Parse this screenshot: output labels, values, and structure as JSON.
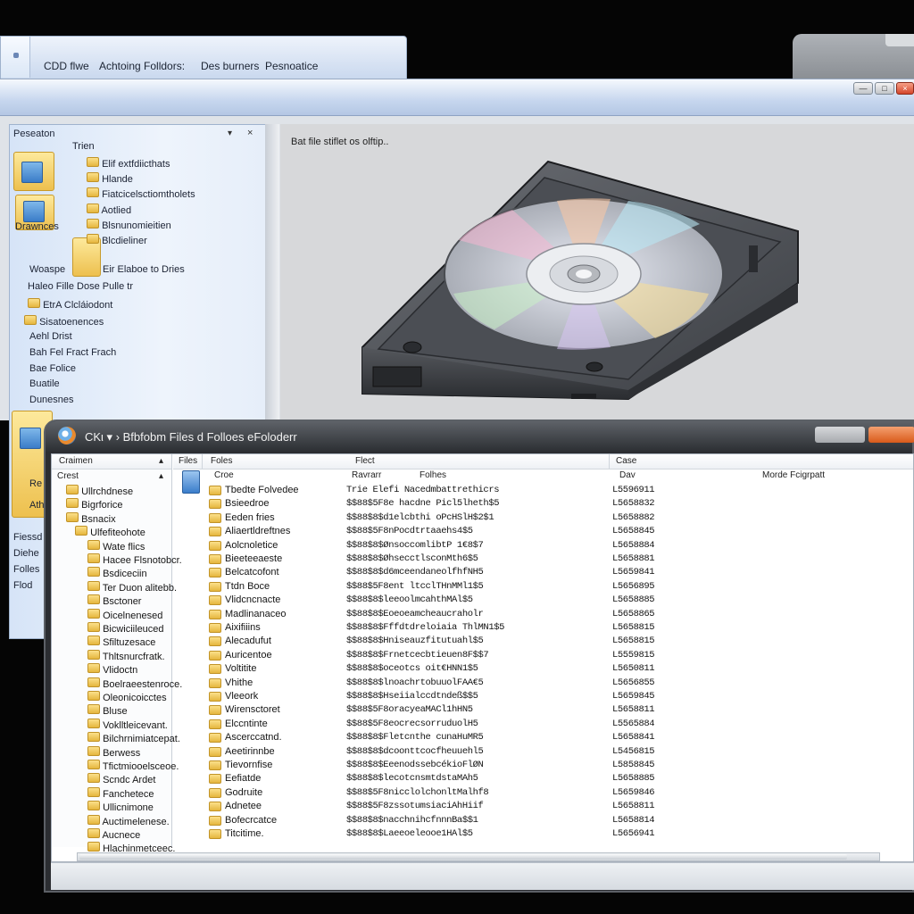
{
  "top_tabs": {
    "items": [
      "CDD flwe",
      "Achtoing Folldors:",
      "Des burners",
      "Pesnoatice"
    ]
  },
  "bg_window": {
    "nav_header": "Peseaton",
    "nav_items": [
      {
        "label": "Trien"
      },
      {
        "label": "Elif extfdiicthats"
      },
      {
        "label": "Hlande"
      },
      {
        "label": "Fiatcicelsctiomtholets"
      },
      {
        "label": "Aotlied"
      },
      {
        "label": "Blsnunomieitien"
      },
      {
        "label": "Blcdieliner"
      },
      {
        "label": "Drawnces"
      },
      {
        "label": "Woaspe"
      },
      {
        "label": "Eir Elaboe to Dries"
      },
      {
        "label": "Haleo Fille Dose Pulle tr"
      },
      {
        "label": "EtrA Clcláiodont"
      },
      {
        "label": "Sisatoenences"
      },
      {
        "label": "Aehl Drist"
      },
      {
        "label": "Bah Fel Fract Frach"
      },
      {
        "label": "Bae Folice"
      },
      {
        "label": "Buatile"
      },
      {
        "label": "Dunesnes"
      }
    ],
    "left_edge_labels": [
      "Fiessd",
      "Diehe",
      "Folles",
      "Flod",
      "Re",
      "Ath"
    ],
    "preview_caption": "Bat file stiflet os olftip.."
  },
  "front_window": {
    "title": "CKι ▾ › Bfbfobm Files d Folloes eFoloderr",
    "nav_header": "Craimen",
    "nav_subheader": "Crest",
    "nav_items": [
      "Ullrchdnese",
      "Bigrforice",
      "Bsnacix",
      "Ulfefiteohote",
      "Wate flics",
      "Hacee Flsnotobcr.",
      "Bsdiceciin",
      "Ter Duon alitebb.",
      "Bsctoner",
      "Oicelnenesed",
      "Bicwiciileuced",
      "Sfiltuzesace",
      "Thltsnurcfratk.",
      "Vlidoctn",
      "Boelraeestenroce.",
      "Oleonicoicctes",
      "Bluse",
      "Voklltleicevant.",
      "Bilchrnimiatcepat.",
      "Berwess",
      "Tfictmiooelsceoe.",
      "Scndc Ardet",
      "Fanchetece",
      "Ullicnimone",
      "Auctimelenese.",
      "Aucnece",
      "Hlachinmetceec."
    ],
    "columns": {
      "files": "Files",
      "foles": "Foles",
      "flect": "Flect",
      "case": "Case",
      "sub_name": "Croe",
      "sub_type": "Ravrarr",
      "sub_fold": "Folhes",
      "sub_date": "Dav",
      "sub_extra": "Morde Fcigrpatt"
    },
    "rows": [
      {
        "name": "Tbedte Folvedee",
        "type": "Trie Elefi Nacedmbattrethicrs",
        "date": "L5596911"
      },
      {
        "name": "Bsieedroe",
        "type": "$$88$5F8e hacdne Picl5lheth$5",
        "date": "L5658832"
      },
      {
        "name": "Eeden fries",
        "type": "$$88$8$d1elcbthi oPcHSlH$2$1",
        "date": "L5658882"
      },
      {
        "name": "Aliaertldreftnes",
        "type": "$$88$5F8nPocdtrtaaehs4$5",
        "date": "L5658845"
      },
      {
        "name": "Aolcnoletice",
        "type": "$$88$8$ØnsoccomlibtP 1€8$7",
        "date": "L5658884"
      },
      {
        "name": "Bieeteeaeste",
        "type": "$$88$8$ØhsecctlsconMth6$5",
        "date": "L5658881"
      },
      {
        "name": "Belcatcofont",
        "type": "$$88$8$d6mceendaneolfhfNH5",
        "date": "L5659841"
      },
      {
        "name": "Ttdn Boce",
        "type": "$$88$5F8ent ltcclTHnMMl1$5",
        "date": "L5656895"
      },
      {
        "name": "Vlidcncnacte",
        "type": "$$88$8$leeoolmcahthMAl$5",
        "date": "L5658885"
      },
      {
        "name": "Madlinanaceo",
        "type": "$$88$8$Eoeoeamcheaucraholr",
        "date": "L5658865"
      },
      {
        "name": "Aixifiiins",
        "type": "$$88$8$Fffdtdreloiaia ThlMN1$5",
        "date": "L5658815"
      },
      {
        "name": "Alecadufut",
        "type": "$$88$8$Hniseauzfitutuahl$5",
        "date": "L5658815"
      },
      {
        "name": "Auricentoe",
        "type": "$$88$8$Frnetcecbtieuen8F$$7",
        "date": "L5559815"
      },
      {
        "name": "Voltitite",
        "type": "$$88$8$oceotcs oit€HNN1$5",
        "date": "L5650811"
      },
      {
        "name": "Vhithe",
        "type": "$$88$8$lnoachrtobuuolFAA€5",
        "date": "L5656855"
      },
      {
        "name": "Vleeork",
        "type": "$$88$8$Hseiialccdtndeß$$5",
        "date": "L5659845"
      },
      {
        "name": "Wirensctoret",
        "type": "$$88$5F8oracyeaMACl1hHN5",
        "date": "L5658811"
      },
      {
        "name": "Elccntinte",
        "type": "$$88$5F8eocrecsorruduolH5",
        "date": "L5565884"
      },
      {
        "name": "Ascerccatnd.",
        "type": "$$88$8$Fletcnthe cunaHuMR5",
        "date": "L5658841"
      },
      {
        "name": "Aeetirinnbe",
        "type": "$$88$8$dcoonttcocfheuuehl5",
        "date": "L5456815"
      },
      {
        "name": "Tievornfise",
        "type": "$$88$8$EeenodssebcékioFlØN",
        "date": "L5858845"
      },
      {
        "name": "Eefiatde",
        "type": "$$88$8$lecotcnsmtdstaMAh5",
        "date": "L5658885"
      },
      {
        "name": "Godruite",
        "type": "$$88$5F8nicclolchonltMalhf8",
        "date": "L5659846"
      },
      {
        "name": "Adnetee",
        "type": "$$88$5F8zssotumsiaciAhHiif",
        "date": "L5658811"
      },
      {
        "name": "Bofecrcatce",
        "type": "$$88$8$nacchnihcfnnnBa$$1",
        "date": "L5658814"
      },
      {
        "name": "Titcitime.",
        "type": "$$88$8$Laeeoeleooe1HAl$5",
        "date": "L5656941"
      }
    ]
  }
}
